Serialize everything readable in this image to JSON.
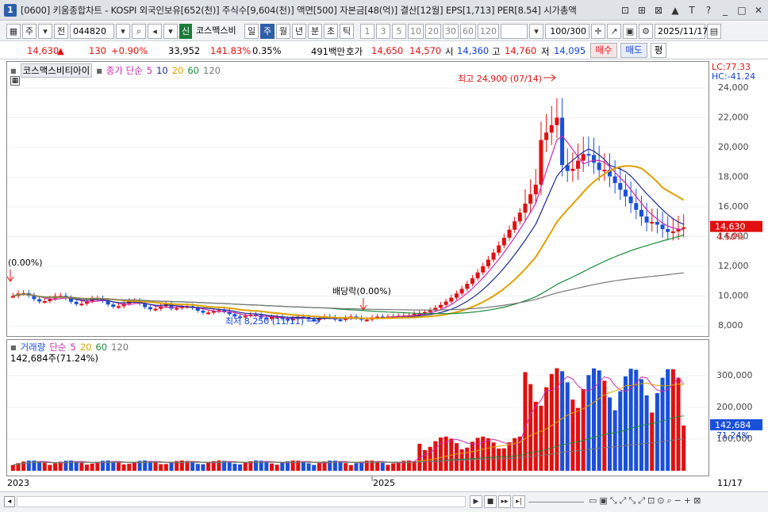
{
  "window": {
    "title": "[0600] 키움종합차트 - KOSPI 외국인보유[652(천)] 주식수[9,604(천)] 액면[500] 자본금[48(억)] 결산[12월] EPS[1,713] PER[8.54] 시가총액",
    "app_badge": "1",
    "controls": [
      "⊡",
      "⊞",
      "⊠",
      "▲",
      "T",
      "?",
      "_",
      "□",
      "✕"
    ]
  },
  "toolbar": {
    "mode": "주",
    "prev": "전",
    "code": "044820",
    "name": "코스맥스비",
    "badge": "신",
    "periods": [
      "일",
      "주",
      "월",
      "년",
      "분",
      "초",
      "틱"
    ],
    "selected_period": "주",
    "intervals": [
      "1",
      "3",
      "5",
      "10",
      "20",
      "30",
      "60",
      "120"
    ],
    "count": "100/300",
    "date": "2025/11/17"
  },
  "quote": {
    "price": "14,630",
    "arrow": "▲",
    "change": "130",
    "rate": "+0.90%",
    "volume": "33,952",
    "vol_ratio": "141.83%",
    "turnover": "0.35%",
    "amount": "491백만",
    "ask_label": "호가",
    "ask": "14,650",
    "bid": "14,570",
    "open_label": "시",
    "open": "14,360",
    "high_label": "고",
    "high": "14,760",
    "low_label": "저",
    "low": "14,095",
    "buy": "매수",
    "sell": "매도",
    "eval": "평"
  },
  "price_panel": {
    "name": "코스맥스비티아이",
    "ma_label": "종가 단순",
    "ma_periods": [
      "5",
      "10",
      "20",
      "60",
      "120"
    ],
    "lc": "LC:77.33",
    "hc": "HC:-41.24",
    "max_label": "최고 24,900 (07/14)",
    "min_label": "최저 8,250 (11/11)",
    "left_label": "(0.00%)",
    "div_label": "배당락(0.00%)",
    "last_price": "14,630",
    "last_rate": "4.50%",
    "y_ticks": [
      "24,000",
      "22,000",
      "20,000",
      "18,000",
      "16,000",
      "14,000",
      "12,000",
      "10,000",
      "8,000"
    ]
  },
  "volume_panel": {
    "label": "거래량",
    "ma_label": "단순",
    "ma_periods": [
      "5",
      "20",
      "60",
      "120"
    ],
    "current": "142,684주(71.24%)",
    "last_vol": "142,684",
    "last_rate": "71.24%",
    "y_ticks": [
      "300,000",
      "200,000",
      "100,000"
    ]
  },
  "date_axis": {
    "labels": [
      "2023",
      "2025",
      "11/17"
    ]
  },
  "colors": {
    "up": "#e01010",
    "down": "#1a50d8",
    "ma5": "#c82ab0",
    "ma10": "#1c2a8a",
    "ma20": "#e0a000",
    "ma60": "#1a8a3a",
    "ma120": "#777777"
  }
}
